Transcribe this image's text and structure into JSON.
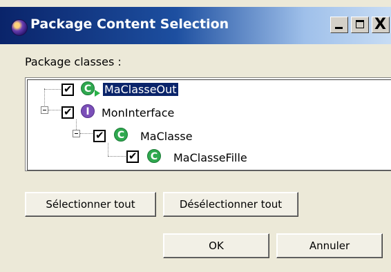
{
  "window": {
    "title": "Package Content Selection",
    "controls": {
      "minimize": "_",
      "maximize": "□",
      "close": "X"
    }
  },
  "label": "Package classes :",
  "tree": {
    "items": [
      {
        "name": "MaClasseOut",
        "checked": true,
        "icon": "class-icon-green-arrow",
        "selected": true
      },
      {
        "name": "MonInterface",
        "checked": true,
        "icon": "interface-icon",
        "expanded": true
      },
      {
        "name": "MaClasse",
        "checked": true,
        "icon": "class-icon",
        "expanded": true
      },
      {
        "name": "MaClasseFille",
        "checked": true,
        "icon": "class-icon"
      }
    ]
  },
  "buttons": {
    "select_all": "Sélectionner tout",
    "deselect_all": "Désélectionner tout",
    "ok": "OK",
    "cancel": "Annuler"
  },
  "colors": {
    "title_gradient_start": "#0a246a",
    "class_icon": "#2fa84f",
    "interface_icon": "#7b4fb8",
    "selection": "#0a246a"
  }
}
